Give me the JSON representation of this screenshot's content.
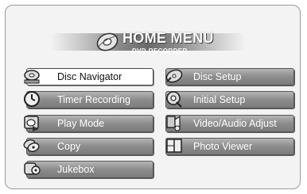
{
  "header": {
    "title": "HOME MENU",
    "subtitle": "DVD RECORDER",
    "logo_icon": "disc-logo-icon"
  },
  "menu": {
    "left": [
      {
        "label": "Disc Navigator",
        "icon": "disc-navigator-icon",
        "selected": true
      },
      {
        "label": "Timer Recording",
        "icon": "clock-icon",
        "selected": false
      },
      {
        "label": "Play Mode",
        "icon": "play-mode-icon",
        "selected": false
      },
      {
        "label": "Copy",
        "icon": "copy-icon",
        "selected": false
      },
      {
        "label": "Jukebox",
        "icon": "jukebox-icon",
        "selected": false
      }
    ],
    "right": [
      {
        "label": "Disc Setup",
        "icon": "disc-setup-icon",
        "selected": false
      },
      {
        "label": "Initial Setup",
        "icon": "initial-setup-icon",
        "selected": false
      },
      {
        "label": "Video/Audio Adjust",
        "icon": "video-audio-adjust-icon",
        "selected": false
      },
      {
        "label": "Photo Viewer",
        "icon": "photo-viewer-icon",
        "selected": false
      }
    ]
  },
  "colors": {
    "button_gray": "#8c8c8c",
    "selected_bg": "#ffffff",
    "background": "#f3f3f3"
  }
}
